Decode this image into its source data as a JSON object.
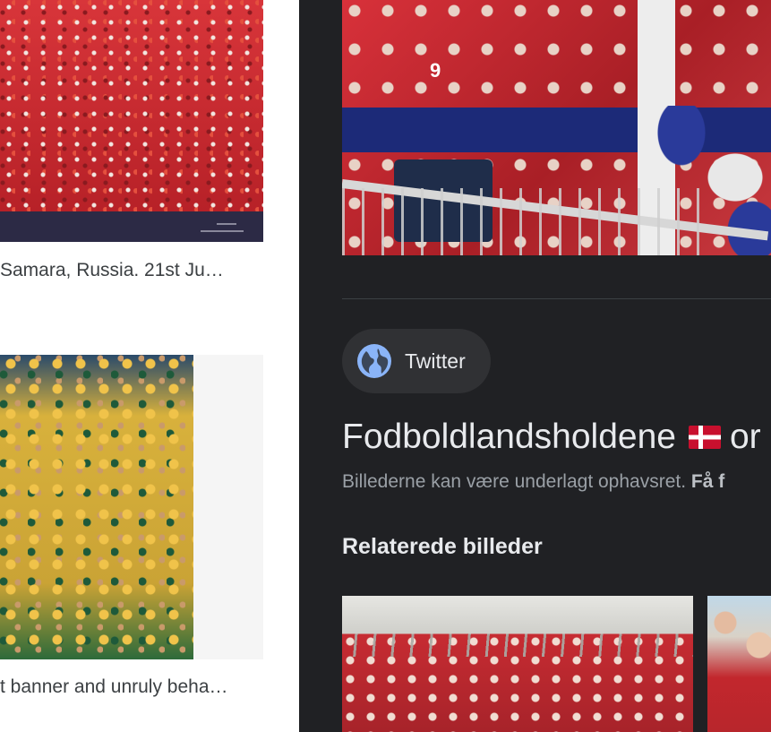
{
  "results": {
    "items": [
      {
        "caption": "Samara, Russia. 21st Ju…"
      },
      {
        "caption": "t banner and unruly beha…"
      }
    ]
  },
  "preview": {
    "image_alt": "Danish football fans celebrating in red shirts",
    "image_jersey_number": "9",
    "source": {
      "name": "Twitter",
      "icon": "globe-icon",
      "icon_color": "#8ab4f8"
    },
    "title": "Fodboldlandsholdene",
    "title_flag": "denmark-flag",
    "title_suffix": "or",
    "copyright_text": "Billederne kan være underlagt ophavsret.",
    "copyright_link": "Få f",
    "related_heading": "Relaterede billeder"
  },
  "colors": {
    "panel_bg": "#202124",
    "chip_bg": "#303134",
    "title_text": "#e8eaed",
    "muted_text": "#9aa0a6",
    "result_caption": "#3c4043"
  }
}
